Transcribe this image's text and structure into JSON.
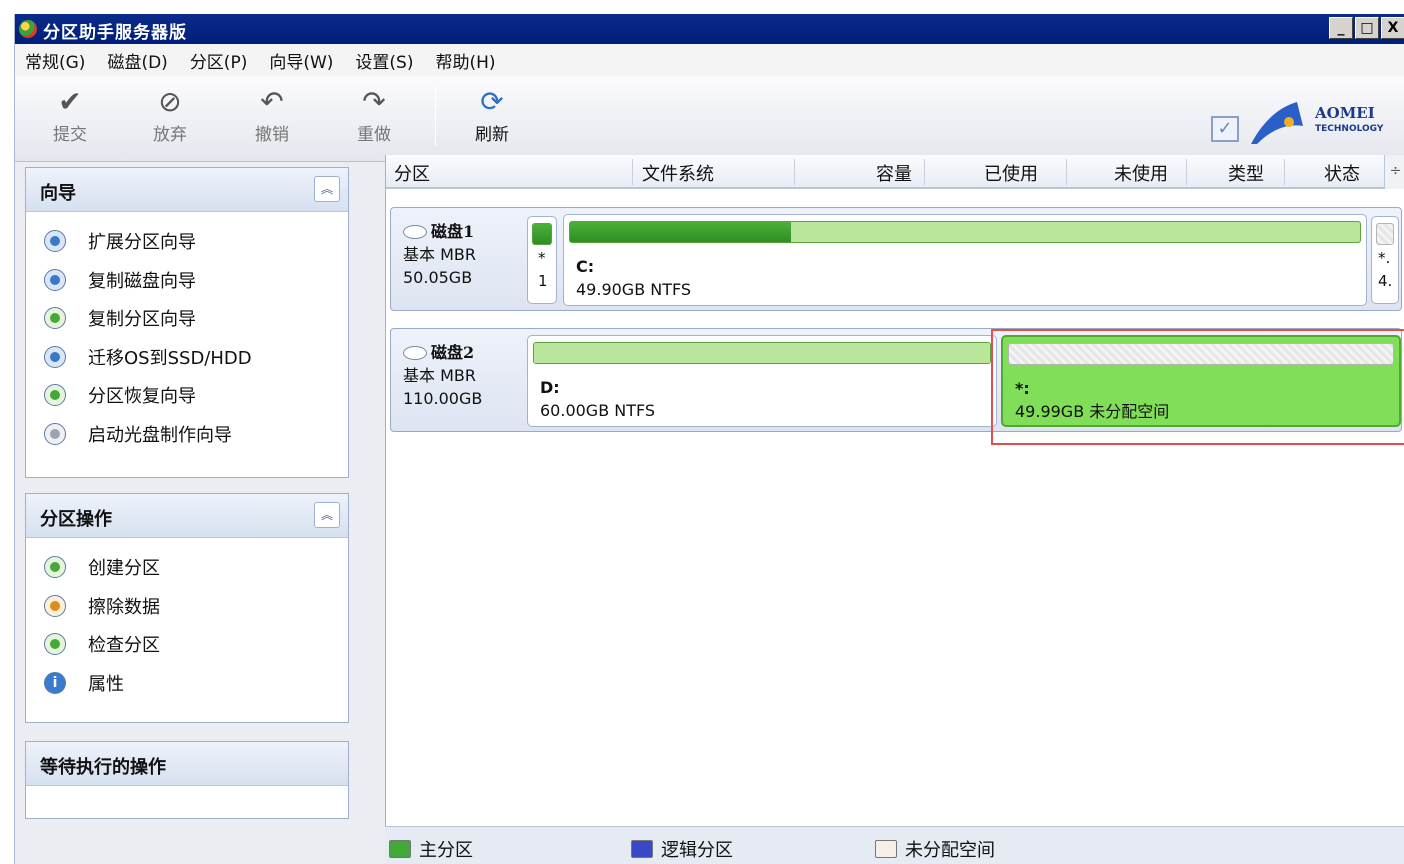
{
  "window": {
    "title": "分区助手服务器版",
    "controls": [
      "_",
      "□",
      "X"
    ]
  },
  "menu": [
    "常规(G)",
    "磁盘(D)",
    "分区(P)",
    "向导(W)",
    "设置(S)",
    "帮助(H)"
  ],
  "toolbar": {
    "buttons": [
      {
        "label": "提交",
        "icon": "checkmark-icon"
      },
      {
        "label": "放弃",
        "icon": "discard-icon"
      },
      {
        "label": "撤销",
        "icon": "undo-icon"
      },
      {
        "label": "重做",
        "icon": "redo-icon"
      },
      {
        "label": "刷新",
        "icon": "refresh-icon"
      }
    ],
    "logo_name": "AOMEI",
    "logo_sub": "TECHNOLOGY"
  },
  "wizard_panel": {
    "title": "向导",
    "items": [
      "扩展分区向导",
      "复制磁盘向导",
      "复制分区向导",
      "迁移OS到SSD/HDD",
      "分区恢复向导",
      "启动光盘制作向导"
    ]
  },
  "ops_panel": {
    "title": "分区操作",
    "items": [
      "创建分区",
      "擦除数据",
      "检查分区",
      "属性"
    ]
  },
  "pending_panel": {
    "title": "等待执行的操作"
  },
  "columns": [
    "分区",
    "文件系统",
    "容量",
    "已使用",
    "未使用",
    "类型",
    "状态"
  ],
  "disks": [
    {
      "name": "磁盘1",
      "type": "基本 MBR",
      "size": "50.05GB",
      "small_left": {
        "line1": "*",
        "line2": "1"
      },
      "main": {
        "name": "C:",
        "detail": "49.90GB NTFS",
        "used_fraction": 0.28
      },
      "small_right": {
        "line1": "*.",
        "line2": "4."
      }
    },
    {
      "name": "磁盘2",
      "type": "基本 MBR",
      "size": "110.00GB",
      "part1": {
        "name": "D:",
        "detail": "60.00GB NTFS",
        "used_fraction": 1.0
      },
      "part2": {
        "name": "*:",
        "detail": "49.99GB 未分配空间"
      }
    }
  ],
  "legend": [
    {
      "label": "主分区",
      "color": "#43a83a"
    },
    {
      "label": "逻辑分区",
      "color": "#3a48c8"
    },
    {
      "label": "未分配空间",
      "color": "#f4f0e8"
    }
  ]
}
